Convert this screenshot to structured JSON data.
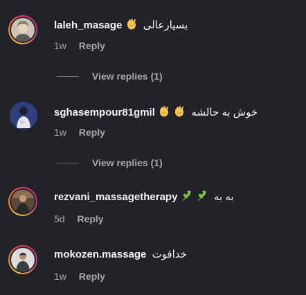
{
  "comments": [
    {
      "username": "laleh_masage",
      "text": "بسیارعالی",
      "emoji": [
        "clap-icon"
      ],
      "time": "1w",
      "reply_label": "Reply",
      "view_replies": "View replies (1)",
      "story_ring": true
    },
    {
      "username": "sghasempour81gmil",
      "text": "خوش به حالشه",
      "emoji": [
        "clap-icon",
        "clap-icon"
      ],
      "time": "1w",
      "reply_label": "Reply",
      "view_replies": "View replies (1)",
      "story_ring": false
    },
    {
      "username": "rezvani_massagetherapy",
      "text": "به به",
      "emoji": [
        "herb-icon",
        "herb-icon"
      ],
      "time": "5d",
      "reply_label": "Reply",
      "story_ring": true
    },
    {
      "username": "mokozen.massage",
      "text": "خداقوت",
      "emoji": [],
      "time": "1w",
      "reply_label": "Reply",
      "story_ring": true
    }
  ],
  "colors": {
    "background": "#212328",
    "text_primary": "#f5f5f5",
    "text_secondary": "#a8a8a8",
    "story_ring": [
      "#fdc830",
      "#f37335",
      "#e1306c",
      "#c13584"
    ]
  }
}
